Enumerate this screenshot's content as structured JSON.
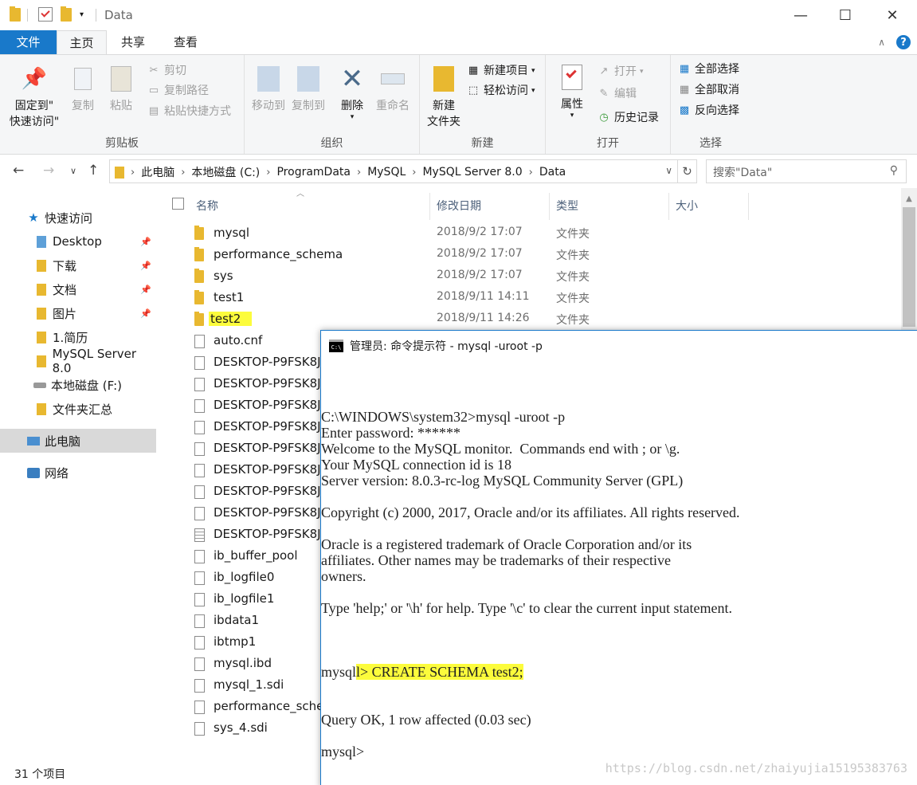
{
  "titlebar": {
    "title": "Data",
    "minimize": "—",
    "maximize": "☐",
    "close": "✕"
  },
  "ribbon_tabs": [
    "文件",
    "主页",
    "共享",
    "查看"
  ],
  "ribbon": {
    "clipboard": {
      "label": "剪贴板",
      "pin": "固定到\"\n快速访问\"",
      "pin_line1": "固定到\"",
      "pin_line2": "快速访问\"",
      "copy": "复制",
      "paste": "粘贴",
      "cut": "剪切",
      "copy_path": "复制路径",
      "paste_shortcut": "粘贴快捷方式"
    },
    "organize": {
      "label": "组织",
      "move_to": "移动到",
      "copy_to": "复制到",
      "delete": "删除",
      "rename": "重命名"
    },
    "new": {
      "label": "新建",
      "new_folder_line1": "新建",
      "new_folder_line2": "文件夹",
      "new_item": "新建项目",
      "easy_access": "轻松访问"
    },
    "open": {
      "label": "打开",
      "properties": "属性",
      "open": "打开",
      "edit": "编辑",
      "history": "历史记录"
    },
    "select": {
      "label": "选择",
      "select_all": "全部选择",
      "select_none": "全部取消",
      "invert": "反向选择"
    }
  },
  "address": {
    "crumbs": [
      "此电脑",
      "本地磁盘 (C:)",
      "ProgramData",
      "MySQL",
      "MySQL Server 8.0",
      "Data"
    ],
    "search_placeholder": "搜索\"Data\""
  },
  "sidebar": {
    "items": [
      {
        "label": "快速访问",
        "icon": "star-icon"
      },
      {
        "label": "Desktop",
        "icon": "folder-icon",
        "pinned": true
      },
      {
        "label": "下载",
        "icon": "download-folder-icon",
        "pinned": true
      },
      {
        "label": "文档",
        "icon": "documents-folder-icon",
        "pinned": true
      },
      {
        "label": "图片",
        "icon": "pictures-folder-icon",
        "pinned": true
      },
      {
        "label": "1.简历",
        "icon": "folder-icon"
      },
      {
        "label": "MySQL Server 8.0",
        "icon": "folder-icon"
      },
      {
        "label": "本地磁盘 (F:)",
        "icon": "drive-icon"
      },
      {
        "label": "文件夹汇总",
        "icon": "folder-icon"
      },
      {
        "label": "此电脑",
        "icon": "computer-icon"
      },
      {
        "label": "网络",
        "icon": "network-icon"
      }
    ]
  },
  "columns": [
    "名称",
    "修改日期",
    "类型",
    "大小"
  ],
  "files": [
    {
      "name": "mysql",
      "date": "2018/9/2 17:07",
      "type": "文件夹",
      "kind": "folder"
    },
    {
      "name": "performance_schema",
      "date": "2018/9/2 17:07",
      "type": "文件夹",
      "kind": "folder"
    },
    {
      "name": "sys",
      "date": "2018/9/2 17:07",
      "type": "文件夹",
      "kind": "folder"
    },
    {
      "name": "test1",
      "date": "2018/9/11 14:11",
      "type": "文件夹",
      "kind": "folder"
    },
    {
      "name": "test2",
      "date": "2018/9/11 14:26",
      "type": "文件夹",
      "kind": "folder",
      "highlight": true
    },
    {
      "name": "auto.cnf",
      "date": "",
      "type": "",
      "kind": "file"
    },
    {
      "name": "DESKTOP-P9FSK8J",
      "date": "",
      "type": "",
      "kind": "file"
    },
    {
      "name": "DESKTOP-P9FSK8J",
      "date": "",
      "type": "",
      "kind": "file"
    },
    {
      "name": "DESKTOP-P9FSK8J",
      "date": "",
      "type": "",
      "kind": "file"
    },
    {
      "name": "DESKTOP-P9FSK8J",
      "date": "",
      "type": "",
      "kind": "file"
    },
    {
      "name": "DESKTOP-P9FSK8J",
      "date": "",
      "type": "",
      "kind": "file"
    },
    {
      "name": "DESKTOP-P9FSK8J",
      "date": "",
      "type": "",
      "kind": "file"
    },
    {
      "name": "DESKTOP-P9FSK8J",
      "date": "",
      "type": "",
      "kind": "file"
    },
    {
      "name": "DESKTOP-P9FSK8J",
      "date": "",
      "type": "",
      "kind": "file"
    },
    {
      "name": "DESKTOP-P9FSK8J",
      "date": "",
      "type": "",
      "kind": "lined"
    },
    {
      "name": "ib_buffer_pool",
      "date": "",
      "type": "",
      "kind": "file"
    },
    {
      "name": "ib_logfile0",
      "date": "",
      "type": "",
      "kind": "file"
    },
    {
      "name": "ib_logfile1",
      "date": "",
      "type": "",
      "kind": "file"
    },
    {
      "name": "ibdata1",
      "date": "",
      "type": "",
      "kind": "file"
    },
    {
      "name": "ibtmp1",
      "date": "",
      "type": "",
      "kind": "file"
    },
    {
      "name": "mysql.ibd",
      "date": "",
      "type": "",
      "kind": "file"
    },
    {
      "name": "mysql_1.sdi",
      "date": "",
      "type": "",
      "kind": "file"
    },
    {
      "name": "performance_sche",
      "date": "",
      "type": "",
      "kind": "file"
    },
    {
      "name": "sys_4.sdi",
      "date": "",
      "type": "",
      "kind": "file"
    }
  ],
  "status": "31 个项目",
  "console": {
    "title": "管理员: 命令提示符 - mysql  -uroot -p",
    "lines": [
      "C:\\WINDOWS\\system32>mysql -uroot -p",
      "Enter password: ******",
      "Welcome to the MySQL monitor.  Commands end with ; or \\g.",
      "Your MySQL connection id is 18",
      "Server version: 8.0.3-rc-log MySQL Community Server (GPL)",
      "",
      "Copyright (c) 2000, 2017, Oracle and/or its affiliates. All rights reserved.",
      "",
      "Oracle is a registered trademark of Oracle Corporation and/or its",
      "affiliates. Other names may be trademarks of their respective",
      "owners.",
      "",
      "Type 'help;' or '\\h' for help. Type '\\c' to clear the current input statement.",
      ""
    ],
    "cmd_prompt": "mysql",
    "cmd_highlight": "l> CREATE SCHEMA test2;",
    "after_lines": [
      "Query OK, 1 row affected (0.03 sec)",
      "",
      "mysql>"
    ]
  },
  "watermark": "https://blog.csdn.net/zhaiyujia15195383763",
  "colors": {
    "accent": "#1979ca",
    "folder": "#e8b830",
    "highlight": "#fcfc3c"
  }
}
